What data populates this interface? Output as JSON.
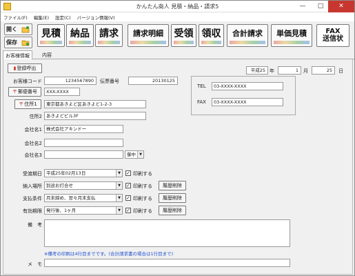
{
  "window": {
    "title": "かんたん商人 見積・納品・請求5",
    "min_glyph": "—",
    "max_glyph": "□",
    "close_glyph": "✕"
  },
  "menu": {
    "items": [
      {
        "label": "ファイル(F)"
      },
      {
        "label": "編集(E)"
      },
      {
        "label": "設定(C)"
      },
      {
        "label": "バージョン情報(V)"
      }
    ]
  },
  "toolbar": {
    "open_label": "開く",
    "save_label": "保存",
    "buttons": [
      {
        "label": "見積"
      },
      {
        "label": "納品"
      },
      {
        "label": "請求"
      },
      {
        "label": "請求明細"
      },
      {
        "label": "受領"
      },
      {
        "label": "領収"
      },
      {
        "label": "合計請求"
      },
      {
        "label": "単価見積"
      },
      {
        "label_line1": "FAX",
        "label_line2": "送信状"
      }
    ]
  },
  "tabs": [
    {
      "label": "お客様情報"
    },
    {
      "label": "内容"
    }
  ],
  "form": {
    "register_call_label": "登録呼出",
    "era": "平成25",
    "year_unit": "年",
    "month": "1",
    "month_unit": "月",
    "day": "25",
    "day_unit": "日",
    "customer_code_label": "お客様コード",
    "customer_code": "1234567890",
    "slip_no_label": "伝票番号",
    "slip_no": "20130125",
    "postal_button": "郵便番号",
    "postal_code": "XXX-XXXX",
    "address1_button": "住所1",
    "address1": "東京都あきよど区あきよど1-2-3",
    "address2_label": "住所2",
    "address2": "あきよどビル3F",
    "company1_label": "会社名1",
    "company1": "株式会社アキンドー",
    "company2_label": "会社名2",
    "company2": "",
    "company3_label": "会社名3",
    "company3": "",
    "honorific": "御中",
    "tel_label": "TEL",
    "tel": "03-XXXX-XXXX",
    "fax_label": "FAX",
    "fax": "03-XXXX-XXXX",
    "delivery_date_label": "受渡期日",
    "delivery_date": "平成25年02月13日",
    "delivery_place_label": "納入場所",
    "delivery_place": "別途お打合せ",
    "payment_label": "支払条件",
    "payment": "月末締め、翌々月末支払",
    "expiry_label": "有効期限",
    "expiry": "発行後、1ヶ月",
    "print_label": "印刷する",
    "history_delete_label": "履歴削除",
    "remarks_label": "備　考",
    "remarks_note": "※備考の印刷は4行目までです。(合計請求書の場合は1行目まで)",
    "memo_label": "メ　モ"
  },
  "colors": {
    "accent_red": "#c0392b",
    "note_blue": "#1f4fd1",
    "close_red": "#c7372f"
  }
}
